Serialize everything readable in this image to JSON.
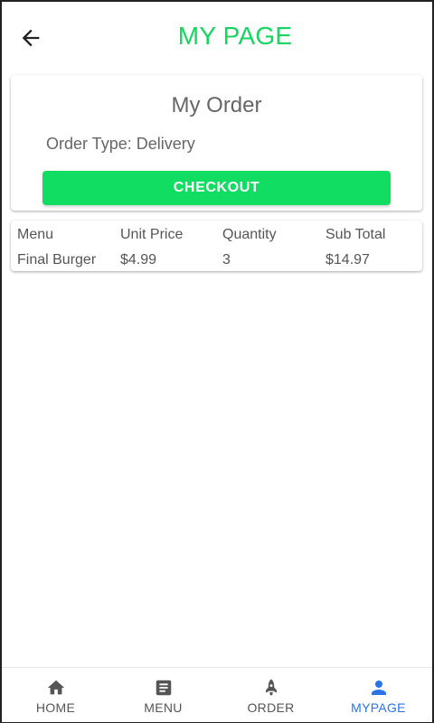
{
  "header": {
    "title": "MY PAGE",
    "back_icon": "arrow-left-icon",
    "title_color": "#15d65f"
  },
  "order_card": {
    "title": "My Order",
    "order_type": "Order Type: Delivery",
    "checkout_label": "CHECKOUT",
    "checkout_color": "#12dd63"
  },
  "order_table": {
    "columns": [
      "Menu",
      "Unit Price",
      "Quantity",
      "Sub Total"
    ],
    "rows": [
      [
        "Final Burger",
        "$4.99",
        "3",
        "$14.97"
      ]
    ]
  },
  "bottom_nav": {
    "items": [
      {
        "label": "HOME",
        "icon": "home-icon"
      },
      {
        "label": "MENU",
        "icon": "menu-list-icon"
      },
      {
        "label": "ORDER",
        "icon": "rocket-icon"
      },
      {
        "label": "MYPAGE",
        "icon": "person-icon"
      }
    ],
    "active": "MYPAGE",
    "active_color": "#2a73e8"
  }
}
